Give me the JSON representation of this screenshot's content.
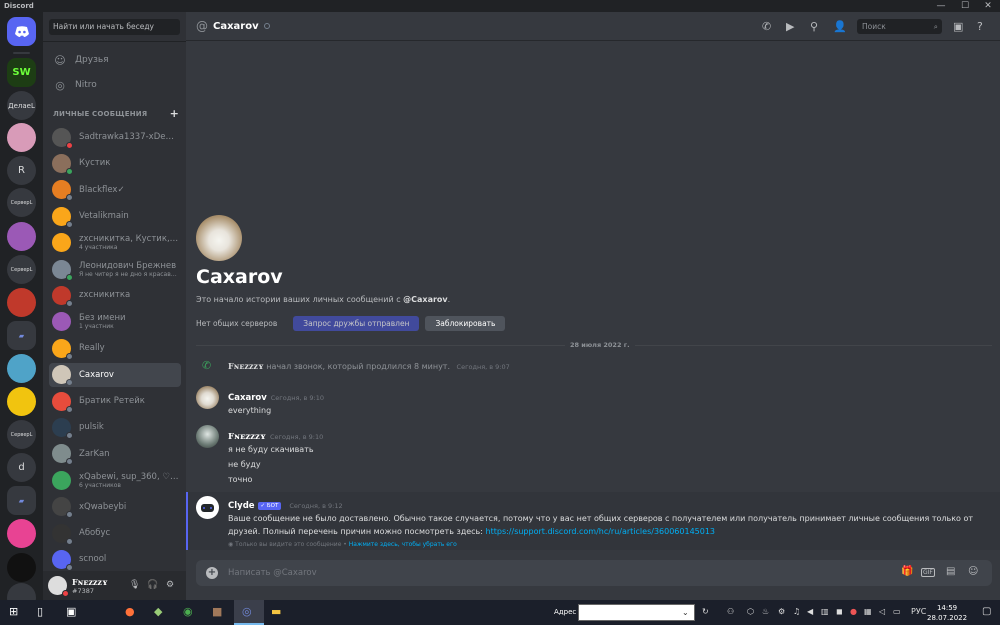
{
  "app": {
    "title": "Discord",
    "window_controls": [
      "—",
      "☐",
      "✕"
    ]
  },
  "guilds": [
    {
      "label": "",
      "icon": "discord-home-icon"
    },
    {
      "label": "SW",
      "color": "#2d5a1e"
    },
    {
      "label": "ДелаеL"
    },
    {
      "label": "",
      "color": "#d89bb8"
    },
    {
      "label": "R"
    },
    {
      "label": "СерверL"
    },
    {
      "label": "",
      "color": "#9b59b6"
    },
    {
      "label": "СерверL"
    },
    {
      "label": "",
      "color": "#c0392b"
    },
    {
      "label": "",
      "icon": "folder-icon"
    },
    {
      "label": "",
      "color": "#4fa3c8"
    },
    {
      "label": "",
      "color": "#f1c40f"
    },
    {
      "label": "СерверL"
    },
    {
      "label": "d"
    },
    {
      "label": "",
      "icon": "folder-icon"
    },
    {
      "label": "",
      "color": "#e84393"
    },
    {
      "label": "",
      "color": "#111"
    }
  ],
  "sidebar": {
    "search_placeholder": "Найти или начать беседу",
    "friends_label": "Друзья",
    "nitro_label": "Nitro",
    "dm_header": "ЛИЧНЫЕ СООБЩЕНИЯ",
    "dms": [
      {
        "name": "Sadtrawka1337-xDedF…",
        "sub": "",
        "color": "#555",
        "status": "#ed4245"
      },
      {
        "name": "Кустик",
        "sub": "",
        "color": "#8b6f5c",
        "status": "#3ba55d"
      },
      {
        "name": "Blackflex✓",
        "sub": "",
        "color": "#e67e22",
        "status": "#747f8d"
      },
      {
        "name": "Vetalikmain",
        "sub": "",
        "color": "#faa61a",
        "status": "#747f8d"
      },
      {
        "name": "zxсникитка, Кустик, Б…",
        "sub": "4 участника",
        "color": "#faa61a",
        "status": ""
      },
      {
        "name": "Леонидович Брежнев",
        "sub": "Я не читер я не дно я красава…",
        "color": "#7b8794",
        "status": "#3ba55d"
      },
      {
        "name": "zxсникитка",
        "sub": "",
        "color": "#c0392b",
        "status": "#747f8d"
      },
      {
        "name": "Без имени",
        "sub": "1 участник",
        "color": "#9b59b6",
        "status": ""
      },
      {
        "name": "Really",
        "sub": "",
        "color": "#faa61a",
        "status": "#747f8d"
      },
      {
        "name": "Caxarov",
        "sub": "",
        "color": "#cfc6b8",
        "status": "#747f8d"
      },
      {
        "name": "Братик Ретейк",
        "sub": "",
        "color": "#e74c3c",
        "status": "#747f8d"
      },
      {
        "name": "pulsik",
        "sub": "",
        "color": "#2c3e50",
        "status": "#747f8d"
      },
      {
        "name": "ZarKan",
        "sub": "",
        "color": "#7f8c8d",
        "status": "#747f8d"
      },
      {
        "name": "xQabewi, sup_360, ♡…",
        "sub": "6 участников",
        "color": "#3ba55d",
        "status": ""
      },
      {
        "name": "xQwabeybi",
        "sub": "",
        "color": "#444",
        "status": "#747f8d"
      },
      {
        "name": "Абобус",
        "sub": "",
        "color": "#333",
        "status": "#747f8d"
      },
      {
        "name": "scnool",
        "sub": "",
        "color": "#5865f2",
        "status": "#747f8d"
      }
    ],
    "user": {
      "name": "Fɴᴇᴢᴢᴢʏ",
      "tag": "#7387"
    }
  },
  "header": {
    "name": "Caxarov",
    "search_placeholder": "Поиск"
  },
  "intro": {
    "name": "Caxarov",
    "desc_prefix": "Это начало истории ваших личных сообщений с ",
    "desc_user": "@Caxarov",
    "desc_suffix": ".",
    "no_servers": "Нет общих серверов",
    "friend_btn": "Запрос дружбы отправлен",
    "block_btn": "Заблокировать"
  },
  "date_divider": "28 июля 2022 г.",
  "call": {
    "user": "Fɴᴇᴢᴢᴢʏ",
    "text": " начал звонок, который продлился 8 минут.",
    "time": "Сегодня, в 9:07"
  },
  "messages": [
    {
      "author": "Caxarov",
      "time": "Сегодня, в 9:10",
      "lines": [
        "everything"
      ]
    },
    {
      "author": "Fɴᴇᴢᴢᴢʏ",
      "time": "Сегодня, в 9:10",
      "lines": [
        "я не буду скачивать",
        "не буду",
        "точно"
      ]
    }
  ],
  "clyde": {
    "author": "Clyde",
    "bot_tag": "✓ БОТ",
    "time": "Сегодня, в 9:12",
    "text1": "Ваше сообщение не было доставлено. Обычно такое случается, потому что у вас нет общих серверов с получателем или получатель принимает личные сообщения только от",
    "text2": "друзей. Полный перечень причин можно посмотреть здесь: ",
    "link": "https://support.discord.com/hc/ru/articles/360060145013",
    "ephem": "Только вы видите это сообщение • ",
    "ephem_link": "Нажмите здесь, чтобы убрать его"
  },
  "composer": {
    "placeholder": "Написать @Caxarov"
  },
  "taskbar": {
    "address_label": "Адрес",
    "lang": "РУС",
    "time": "14:59",
    "date": "28.07.2022"
  }
}
